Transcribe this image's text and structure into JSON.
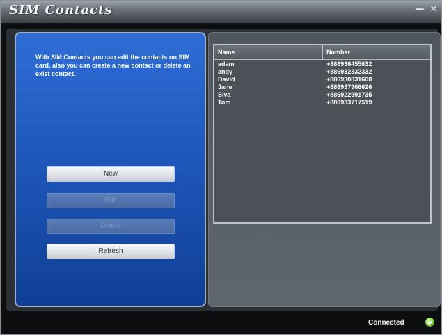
{
  "window": {
    "title": "SIM Contacts",
    "minimize_glyph": "—",
    "close_glyph": "✕"
  },
  "left_panel": {
    "description": "With SIM Contacts you can edit the contacts on SIM card, also you can create a new contact or delete an exist contact.",
    "buttons": {
      "new": "New",
      "edit": "Edit",
      "delete": "Delete",
      "refresh": "Refresh"
    }
  },
  "contacts_table": {
    "columns": [
      "Name",
      "Number"
    ],
    "rows": [
      {
        "name": "adam",
        "number": "+886936455632"
      },
      {
        "name": "andy",
        "number": "+886932332332"
      },
      {
        "name": "David",
        "number": "+886930831608"
      },
      {
        "name": "Jane",
        "number": "+886937966626"
      },
      {
        "name": "Siva",
        "number": "+886922991735"
      },
      {
        "name": "Tom",
        "number": "+886933717519"
      }
    ]
  },
  "status": {
    "text": "Connected",
    "icon": "check-circle-icon",
    "color": "#7fd63a"
  },
  "colors": {
    "left_panel_blue": "#1d55b8",
    "right_panel_gray": "#555a61",
    "window_background": "#0d0e10"
  }
}
